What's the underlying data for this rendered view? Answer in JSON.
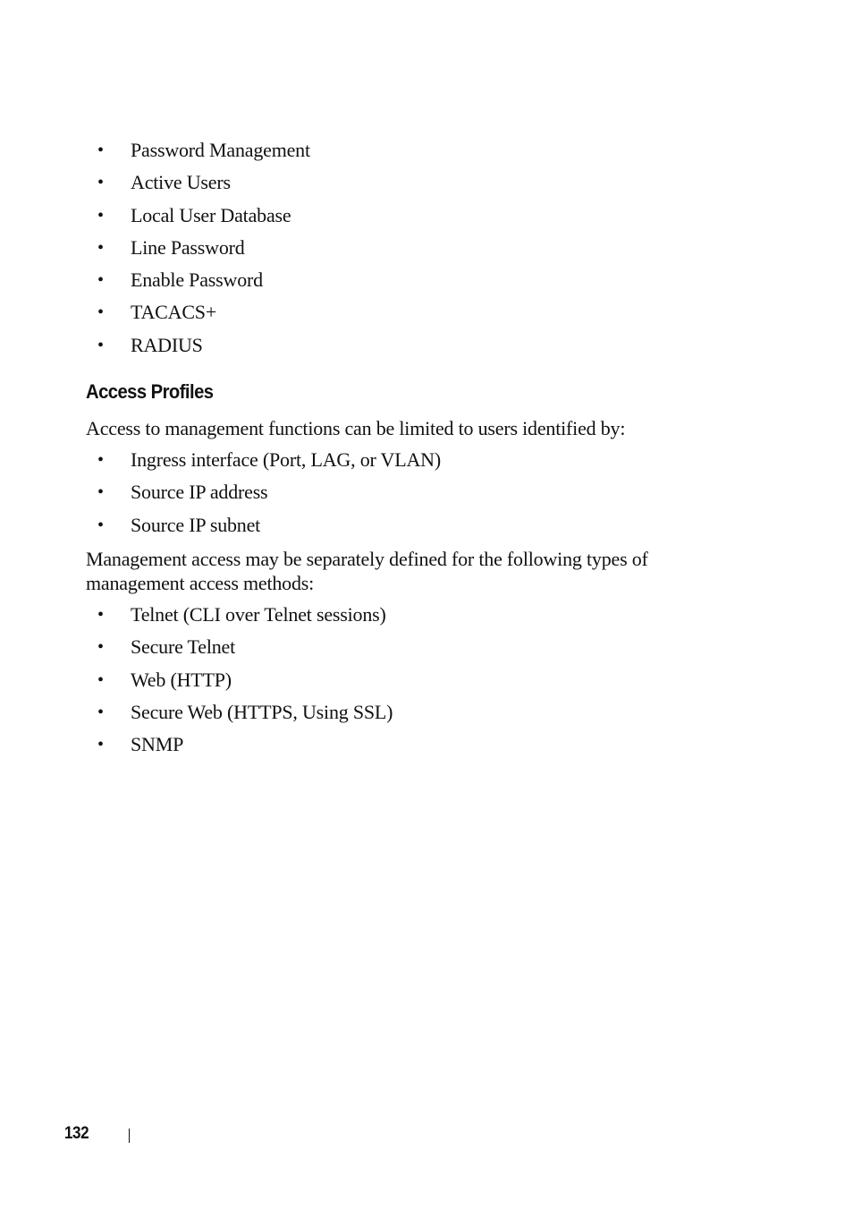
{
  "document": {
    "list_top": [
      "Password Management",
      "Active Users",
      "Local User Database",
      "Line Password",
      "Enable Password",
      "TACACS+",
      "RADIUS"
    ],
    "section": {
      "heading": "Access Profiles",
      "intro": "Access to management functions can be limited to users identified by:",
      "identifiers": [
        "Ingress interface (Port, LAG, or VLAN)",
        "Source IP address",
        "Source IP subnet"
      ],
      "methods_intro": "Management access may be separately defined for the following types of management access methods:",
      "methods": [
        "Telnet (CLI over Telnet sessions)",
        "Secure Telnet",
        "Web (HTTP)",
        "Secure Web (HTTPS, Using SSL)",
        "SNMP"
      ]
    },
    "bullet_glyph": "•"
  },
  "footer": {
    "page_number": "132"
  }
}
